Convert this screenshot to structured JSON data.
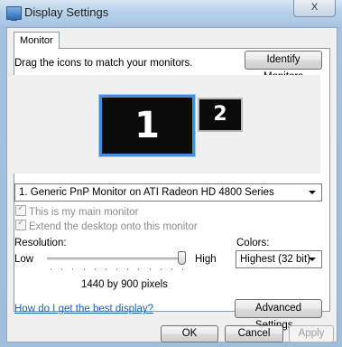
{
  "window": {
    "title": "Display Settings",
    "close_label": "X"
  },
  "tabs": [
    {
      "label": "Monitor"
    }
  ],
  "monitor_tab": {
    "instruction": "Drag the icons to match your monitors.",
    "identify_button": "Identify Monitors",
    "monitors": [
      {
        "label": "1",
        "selected": true
      },
      {
        "label": "2",
        "selected": false
      }
    ],
    "monitor_select": {
      "value": "1. Generic PnP Monitor on ATI Radeon HD 4800 Series"
    },
    "checkboxes": [
      {
        "label": "This is my main monitor",
        "checked": true,
        "enabled": false
      },
      {
        "label": "Extend the desktop onto this monitor",
        "checked": true,
        "enabled": false
      }
    ],
    "resolution": {
      "label": "Resolution:",
      "low_label": "Low",
      "high_label": "High",
      "value_text": "1440 by 900 pixels",
      "slider_level": 1.0
    },
    "colors": {
      "label": "Colors:",
      "value": "Highest (32 bit)"
    },
    "help_link": "How do I get the best display?",
    "advanced_button": "Advanced Settings..."
  },
  "dialog_buttons": {
    "ok": "OK",
    "cancel": "Cancel",
    "apply": "Apply"
  },
  "colors_theme": {
    "link": "#1a5fb4",
    "selected_monitor_border": "#3d8fe0"
  }
}
